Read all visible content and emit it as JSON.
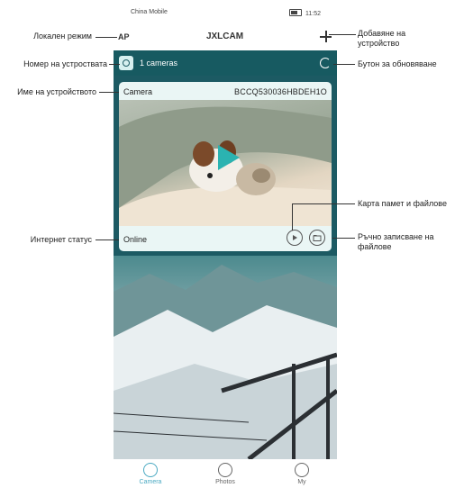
{
  "status_bar": {
    "carrier": "China Mobile",
    "time": "11:52"
  },
  "top_bar": {
    "mode": "AP",
    "title": "JXLCAM"
  },
  "device_count": "1 cameras",
  "device_card": {
    "name": "Camera",
    "serial": "BCCQ530036HBDEH1O",
    "status": "Online"
  },
  "tabs": [
    {
      "label": "Camera",
      "active": true
    },
    {
      "label": "Photos",
      "active": false
    },
    {
      "label": "My",
      "active": false
    }
  ],
  "annotations": {
    "local_mode": "Локален режим",
    "device_count": "Номер на устроствата",
    "device_name": "Име на устройството",
    "internet_status": "Интернет статус",
    "add_device": "Добавяне на устройство",
    "refresh_button": "Бутон за обновяване",
    "memory_card": "Карта памет и файлове",
    "manual_recording": "Ръчно записване на файлове"
  },
  "colors": {
    "teal": "#1c5a63",
    "accent": "#4aa9c2",
    "play": "#2bb3b1"
  }
}
